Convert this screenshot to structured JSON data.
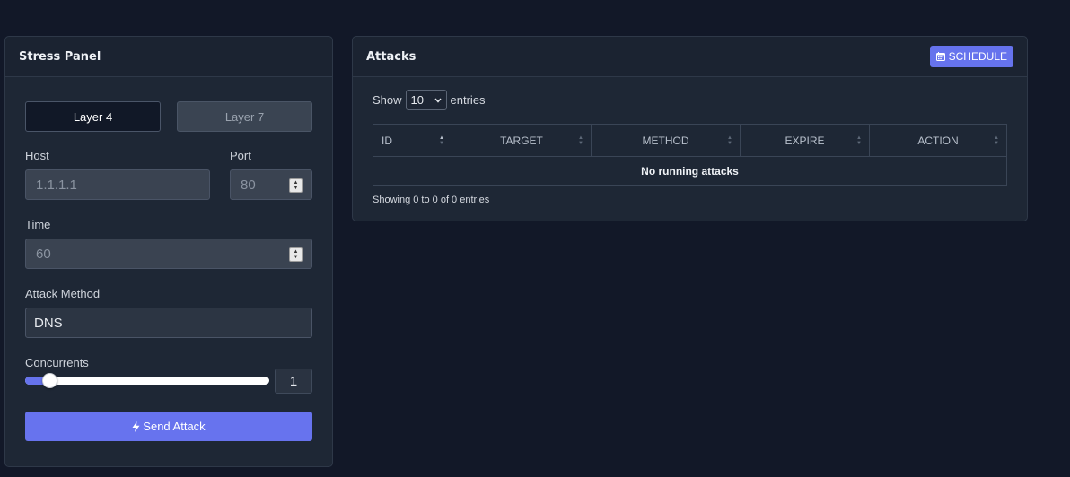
{
  "stress_panel": {
    "title": "Stress Panel",
    "layer4_label": "Layer 4",
    "layer7_label": "Layer 7",
    "host_label": "Host",
    "host_placeholder": "1.1.1.1",
    "port_label": "Port",
    "port_placeholder": "80",
    "time_label": "Time",
    "time_placeholder": "60",
    "method_label": "Attack Method",
    "method_value": "DNS",
    "concurrents_label": "Concurrents",
    "concurrents_value": "1",
    "concurrents_fraction": 0.1,
    "send_label": "Send Attack"
  },
  "attacks_panel": {
    "title": "Attacks",
    "schedule_label": "SCHEDULE",
    "show_label": "Show",
    "entries_select": "10",
    "entries_label": "entries",
    "columns": [
      "ID",
      "TARGET",
      "METHOD",
      "EXPIRE",
      "ACTION"
    ],
    "empty_message": "No running attacks",
    "info": "Showing 0 to 0 of 0 entries"
  },
  "colors": {
    "accent": "#6673ed",
    "background": "#121828",
    "card": "#1e2735"
  }
}
